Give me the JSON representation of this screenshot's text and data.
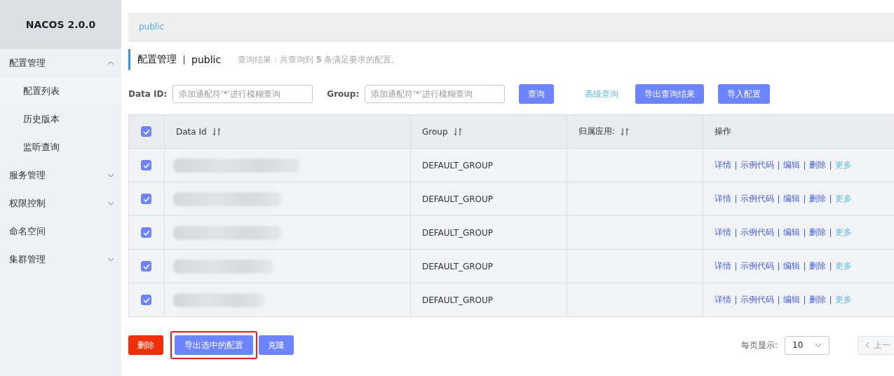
{
  "sidebar": {
    "title": "NACOS 2.0.0",
    "items": [
      {
        "label": "配置管理",
        "expanded": true,
        "children": [
          {
            "label": "配置列表",
            "selected": true
          },
          {
            "label": "历史版本",
            "selected": false
          },
          {
            "label": "监听查询",
            "selected": false
          }
        ]
      },
      {
        "label": "服务管理",
        "expanded": false
      },
      {
        "label": "权限控制",
        "expanded": false
      },
      {
        "label": "命名空间"
      },
      {
        "label": "集群管理",
        "expanded": false
      }
    ]
  },
  "namespace_bar": {
    "items": [
      {
        "label": "public",
        "selected": true
      }
    ]
  },
  "page_header": {
    "title": "配置管理",
    "namespace": "public",
    "result_text": "查询结果：共查询到 **5** 条满足要求的配置。"
  },
  "search": {
    "fields": [
      {
        "label": "Data ID:",
        "placeholder": "添加通配符'*'进行模糊查询"
      },
      {
        "label": "Group:",
        "placeholder": "添加通配符'*'进行模糊查询"
      }
    ],
    "actions": [
      {
        "label": "查询",
        "kind": "button"
      },
      {
        "label": "高级查询",
        "kind": "link"
      },
      {
        "label": "导出查询结果",
        "kind": "button"
      },
      {
        "label": "导入配置",
        "kind": "button"
      }
    ]
  },
  "table": {
    "all_checked": true,
    "columns": [
      {
        "label": "Data Id",
        "sortable": true
      },
      {
        "label": "Group",
        "sortable": true
      },
      {
        "label": "归属应用:",
        "sortable": true
      },
      {
        "label": "操作",
        "sortable": false
      }
    ],
    "rows": [
      {
        "checked": true,
        "group": "DEFAULT_GROUP",
        "actions": [
          {
            "label": "详情",
            "kind": "action"
          },
          {
            "label": "示例代码",
            "kind": "action"
          },
          {
            "label": "编辑",
            "kind": "action"
          },
          {
            "label": "删除",
            "kind": "action"
          },
          {
            "label": "更多",
            "kind": "more"
          }
        ]
      },
      {
        "checked": true,
        "group": "DEFAULT_GROUP",
        "actions": [
          {
            "label": "详情",
            "kind": "action"
          },
          {
            "label": "示例代码",
            "kind": "action"
          },
          {
            "label": "编辑",
            "kind": "action"
          },
          {
            "label": "删除",
            "kind": "action"
          },
          {
            "label": "更多",
            "kind": "more"
          }
        ]
      },
      {
        "checked": true,
        "group": "DEFAULT_GROUP",
        "actions": [
          {
            "label": "详情",
            "kind": "action"
          },
          {
            "label": "示例代码",
            "kind": "action"
          },
          {
            "label": "编辑",
            "kind": "action"
          },
          {
            "label": "删除",
            "kind": "action"
          },
          {
            "label": "更多",
            "kind": "more"
          }
        ]
      },
      {
        "checked": true,
        "group": "DEFAULT_GROUP",
        "actions": [
          {
            "label": "详情",
            "kind": "action"
          },
          {
            "label": "示例代码",
            "kind": "action"
          },
          {
            "label": "编辑",
            "kind": "action"
          },
          {
            "label": "删除",
            "kind": "action"
          },
          {
            "label": "更多",
            "kind": "more"
          }
        ]
      },
      {
        "checked": true,
        "group": "DEFAULT_GROUP",
        "actions": [
          {
            "label": "详情",
            "kind": "action"
          },
          {
            "label": "示例代码",
            "kind": "action"
          },
          {
            "label": "编辑",
            "kind": "action"
          },
          {
            "label": "删除",
            "kind": "action"
          },
          {
            "label": "更多",
            "kind": "more"
          }
        ]
      }
    ]
  },
  "bulk_actions": [
    {
      "label": "删除",
      "kind": "danger",
      "highlighted": false
    },
    {
      "label": "导出选中的配置",
      "kind": "primary",
      "highlighted": true
    },
    {
      "label": "克隆",
      "kind": "primary",
      "highlighted": false
    }
  ],
  "pagination": {
    "page_size_label": "每页显示:",
    "page_size": "10",
    "prev": {
      "label": "上一",
      "disabled": true
    }
  }
}
